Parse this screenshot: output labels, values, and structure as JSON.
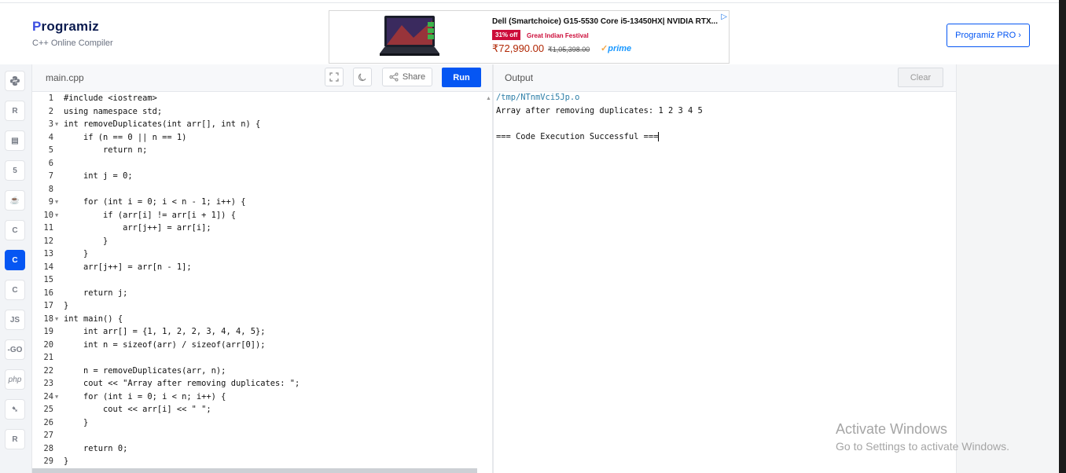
{
  "header": {
    "logo_text": "rogramiz",
    "logo_letter": "P",
    "subtitle": "C++ Online Compiler",
    "pro_button": "Programiz PRO ›"
  },
  "ad": {
    "title": "Dell (Smartchoice) G15-5530 Core i5-13450HX| NVIDIA RTX...",
    "badge": "31% off",
    "promo": "Great Indian Festival",
    "price": "₹72,990.00",
    "mrp": "₹1,05,398.00",
    "prime": "prime",
    "info_icon": "▷"
  },
  "sidebar": {
    "languages": [
      {
        "name": "python",
        "glyph": "Py",
        "active": false
      },
      {
        "name": "r",
        "glyph": "R",
        "active": false
      },
      {
        "name": "sql",
        "glyph": "▤",
        "active": false
      },
      {
        "name": "html",
        "glyph": "5",
        "active": false
      },
      {
        "name": "java",
        "glyph": "☕",
        "active": false
      },
      {
        "name": "c",
        "glyph": "C",
        "active": false
      },
      {
        "name": "cpp",
        "glyph": "C",
        "active": true
      },
      {
        "name": "csharp",
        "glyph": "C",
        "active": false
      },
      {
        "name": "js",
        "glyph": "JS",
        "active": false
      },
      {
        "name": "go",
        "glyph": "-GO",
        "active": false
      },
      {
        "name": "php",
        "glyph": "php",
        "active": false
      },
      {
        "name": "swift",
        "glyph": "➷",
        "active": false
      },
      {
        "name": "rust",
        "glyph": "R",
        "active": false
      }
    ]
  },
  "editor": {
    "file_name": "main.cpp",
    "share_label": "Share",
    "run_label": "Run",
    "lines": [
      {
        "n": "1",
        "fold": false,
        "code": "#include <iostream>"
      },
      {
        "n": "2",
        "fold": false,
        "code": "using namespace std;"
      },
      {
        "n": "3",
        "fold": true,
        "code": "int removeDuplicates(int arr[], int n) {"
      },
      {
        "n": "4",
        "fold": false,
        "code": "    if (n == 0 || n == 1)"
      },
      {
        "n": "5",
        "fold": false,
        "code": "        return n;"
      },
      {
        "n": "6",
        "fold": false,
        "code": ""
      },
      {
        "n": "7",
        "fold": false,
        "code": "    int j = 0;"
      },
      {
        "n": "8",
        "fold": false,
        "code": ""
      },
      {
        "n": "9",
        "fold": true,
        "code": "    for (int i = 0; i < n - 1; i++) {"
      },
      {
        "n": "10",
        "fold": true,
        "code": "        if (arr[i] != arr[i + 1]) {"
      },
      {
        "n": "11",
        "fold": false,
        "code": "            arr[j++] = arr[i];"
      },
      {
        "n": "12",
        "fold": false,
        "code": "        }"
      },
      {
        "n": "13",
        "fold": false,
        "code": "    }"
      },
      {
        "n": "14",
        "fold": false,
        "code": "    arr[j++] = arr[n - 1];"
      },
      {
        "n": "15",
        "fold": false,
        "code": ""
      },
      {
        "n": "16",
        "fold": false,
        "code": "    return j;"
      },
      {
        "n": "17",
        "fold": false,
        "code": "}"
      },
      {
        "n": "18",
        "fold": true,
        "code": "int main() {"
      },
      {
        "n": "19",
        "fold": false,
        "code": "    int arr[] = {1, 1, 2, 2, 3, 4, 4, 5};"
      },
      {
        "n": "20",
        "fold": false,
        "code": "    int n = sizeof(arr) / sizeof(arr[0]);"
      },
      {
        "n": "21",
        "fold": false,
        "code": ""
      },
      {
        "n": "22",
        "fold": false,
        "code": "    n = removeDuplicates(arr, n);"
      },
      {
        "n": "23",
        "fold": false,
        "code": "    cout << \"Array after removing duplicates: \";"
      },
      {
        "n": "24",
        "fold": true,
        "code": "    for (int i = 0; i < n; i++) {"
      },
      {
        "n": "25",
        "fold": false,
        "code": "        cout << arr[i] << \" \";"
      },
      {
        "n": "26",
        "fold": false,
        "code": "    }"
      },
      {
        "n": "27",
        "fold": false,
        "code": ""
      },
      {
        "n": "28",
        "fold": false,
        "code": "    return 0;"
      },
      {
        "n": "29",
        "fold": false,
        "code": "}"
      }
    ]
  },
  "output": {
    "title": "Output",
    "clear_label": "Clear",
    "path": "/tmp/NTnmVci5Jp.o",
    "result": "Array after removing duplicates: 1 2 3 4 5",
    "status": "=== Code Execution Successful ==="
  },
  "watermark": {
    "line1": "Activate Windows",
    "line2": "Go to Settings to activate Windows."
  }
}
